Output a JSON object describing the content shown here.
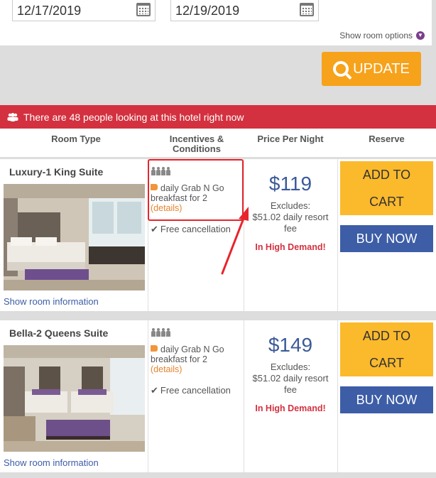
{
  "search": {
    "checkin": "12/17/2019",
    "checkout": "12/19/2019",
    "room_options_label": "Show room options",
    "update_label": "UPDATE"
  },
  "alert": {
    "text": "There are 48 people looking at this hotel right now"
  },
  "table_headers": {
    "room_type": "Room Type",
    "incentives": "Incentives &",
    "incentives_line2": "Conditions",
    "price": "Price Per Night",
    "reserve": "Reserve"
  },
  "rooms": [
    {
      "name": "Luxury-1 King Suite",
      "show_info": "Show room information",
      "incentive_line1": "daily Grab N Go",
      "incentive_line2": "breakfast for 2",
      "details": "(details)",
      "cancellation": "Free cancellation",
      "price": "$119",
      "excludes_line1": "Excludes:",
      "excludes_line2": "$51.02 daily resort",
      "excludes_line3": "fee",
      "demand": "In High Demand!",
      "add_to_cart_line1": "ADD TO",
      "add_to_cart_line2": "CART",
      "buy_now": "BUY NOW"
    },
    {
      "name": "Bella-2 Queens Suite",
      "show_info": "Show room information",
      "incentive_line1": "daily Grab N Go",
      "incentive_line2": "breakfast for 2",
      "details": "(details)",
      "cancellation": "Free cancellation",
      "price": "$149",
      "excludes_line1": "Excludes:",
      "excludes_line2": "$51.02 daily resort",
      "excludes_line3": "fee",
      "demand": "In High Demand!",
      "add_to_cart_line1": "ADD TO",
      "add_to_cart_line2": "CART",
      "buy_now": "BUY NOW"
    }
  ],
  "colors": {
    "update_orange": "#f7a21b",
    "alert_red": "#d3313f",
    "price_blue": "#3b5a99",
    "add_cart_yellow": "#fbb92c",
    "buy_now_blue": "#3d5da6",
    "annotation_red": "#e8242b"
  }
}
